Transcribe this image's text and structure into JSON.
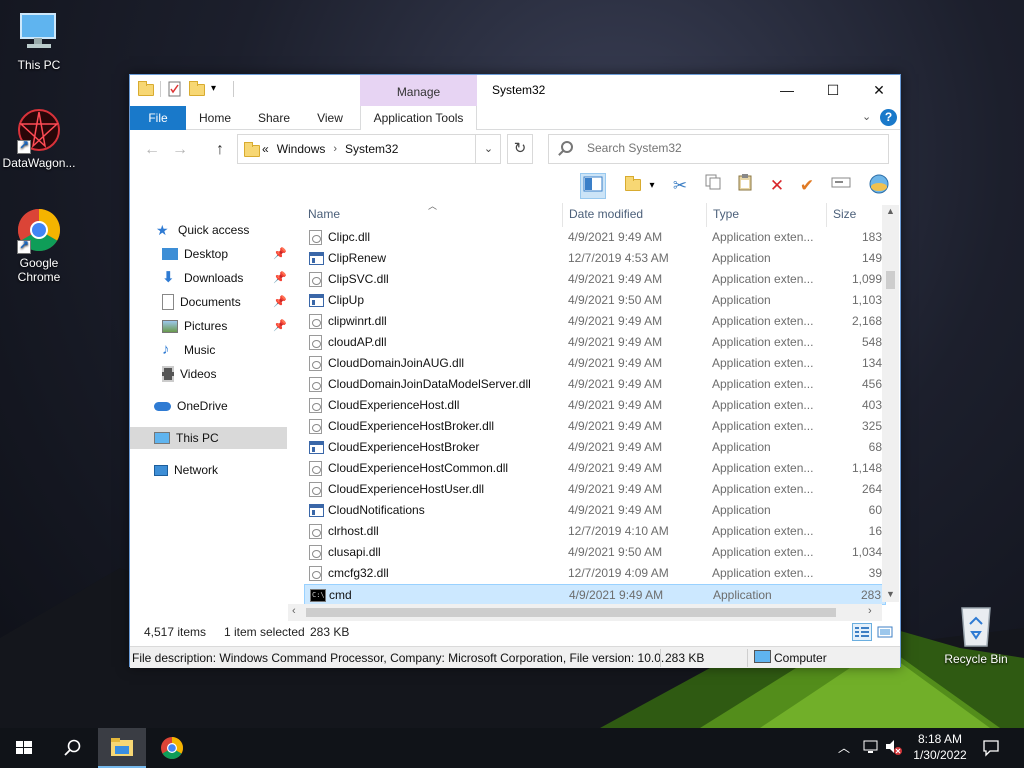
{
  "desktop": {
    "icons": [
      {
        "label": "This PC"
      },
      {
        "label": "DataWagon..."
      },
      {
        "label": "Google Chrome"
      },
      {
        "label": "Recycle Bin"
      }
    ]
  },
  "window": {
    "title": "System32",
    "manage_label": "Manage",
    "ribbon_tabs": {
      "file": "File",
      "home": "Home",
      "share": "Share",
      "view": "View",
      "app_tools": "Application Tools"
    },
    "help": "?",
    "controls": {
      "minimize": "—",
      "maximize": "☐",
      "close": "✕"
    }
  },
  "address": {
    "prefix": "«",
    "crumbs": [
      "Windows",
      "System32"
    ]
  },
  "search": {
    "placeholder": "Search System32"
  },
  "navpane": {
    "quick_access": "Quick access",
    "items": [
      {
        "label": "Desktop"
      },
      {
        "label": "Downloads"
      },
      {
        "label": "Documents"
      },
      {
        "label": "Pictures"
      },
      {
        "label": "Music"
      },
      {
        "label": "Videos"
      }
    ],
    "onedrive": "OneDrive",
    "this_pc": "This PC",
    "network": "Network"
  },
  "columns": {
    "name": "Name",
    "date": "Date modified",
    "type": "Type",
    "size": "Size"
  },
  "files": [
    {
      "name": "Clipc.dll",
      "date": "4/9/2021 9:49 AM",
      "type": "Application exten...",
      "size": "183"
    },
    {
      "name": "ClipRenew",
      "date": "12/7/2019 4:53 AM",
      "type": "Application",
      "size": "149"
    },
    {
      "name": "ClipSVC.dll",
      "date": "4/9/2021 9:49 AM",
      "type": "Application exten...",
      "size": "1,099"
    },
    {
      "name": "ClipUp",
      "date": "4/9/2021 9:50 AM",
      "type": "Application",
      "size": "1,103"
    },
    {
      "name": "clipwinrt.dll",
      "date": "4/9/2021 9:49 AM",
      "type": "Application exten...",
      "size": "2,168"
    },
    {
      "name": "cloudAP.dll",
      "date": "4/9/2021 9:49 AM",
      "type": "Application exten...",
      "size": "548"
    },
    {
      "name": "CloudDomainJoinAUG.dll",
      "date": "4/9/2021 9:49 AM",
      "type": "Application exten...",
      "size": "134"
    },
    {
      "name": "CloudDomainJoinDataModelServer.dll",
      "date": "4/9/2021 9:49 AM",
      "type": "Application exten...",
      "size": "456"
    },
    {
      "name": "CloudExperienceHost.dll",
      "date": "4/9/2021 9:49 AM",
      "type": "Application exten...",
      "size": "403"
    },
    {
      "name": "CloudExperienceHostBroker.dll",
      "date": "4/9/2021 9:49 AM",
      "type": "Application exten...",
      "size": "325"
    },
    {
      "name": "CloudExperienceHostBroker",
      "date": "4/9/2021 9:49 AM",
      "type": "Application",
      "size": "68"
    },
    {
      "name": "CloudExperienceHostCommon.dll",
      "date": "4/9/2021 9:49 AM",
      "type": "Application exten...",
      "size": "1,148"
    },
    {
      "name": "CloudExperienceHostUser.dll",
      "date": "4/9/2021 9:49 AM",
      "type": "Application exten...",
      "size": "264"
    },
    {
      "name": "CloudNotifications",
      "date": "4/9/2021 9:49 AM",
      "type": "Application",
      "size": "60"
    },
    {
      "name": "clrhost.dll",
      "date": "12/7/2019 4:10 AM",
      "type": "Application exten...",
      "size": "16"
    },
    {
      "name": "clusapi.dll",
      "date": "4/9/2021 9:50 AM",
      "type": "Application exten...",
      "size": "1,034"
    },
    {
      "name": "cmcfg32.dll",
      "date": "12/7/2019 4:09 AM",
      "type": "Application exten...",
      "size": "39"
    },
    {
      "name": "cmd",
      "date": "4/9/2021 9:49 AM",
      "type": "Application",
      "size": "283"
    }
  ],
  "status": {
    "count": "4,517 items",
    "selected": "1 item selected",
    "selected_size": "283 KB"
  },
  "details": {
    "description": "File description: Windows Command Processor, Company: Microsoft Corporation, File version: 10.0.",
    "size": "283 KB",
    "location": "Computer"
  },
  "taskbar": {
    "time": "8:18 AM",
    "date": "1/30/2022"
  },
  "colors": {
    "accent": "#1979ca",
    "manage_tab": "#e7d4f3",
    "selection": "#cce8ff"
  }
}
